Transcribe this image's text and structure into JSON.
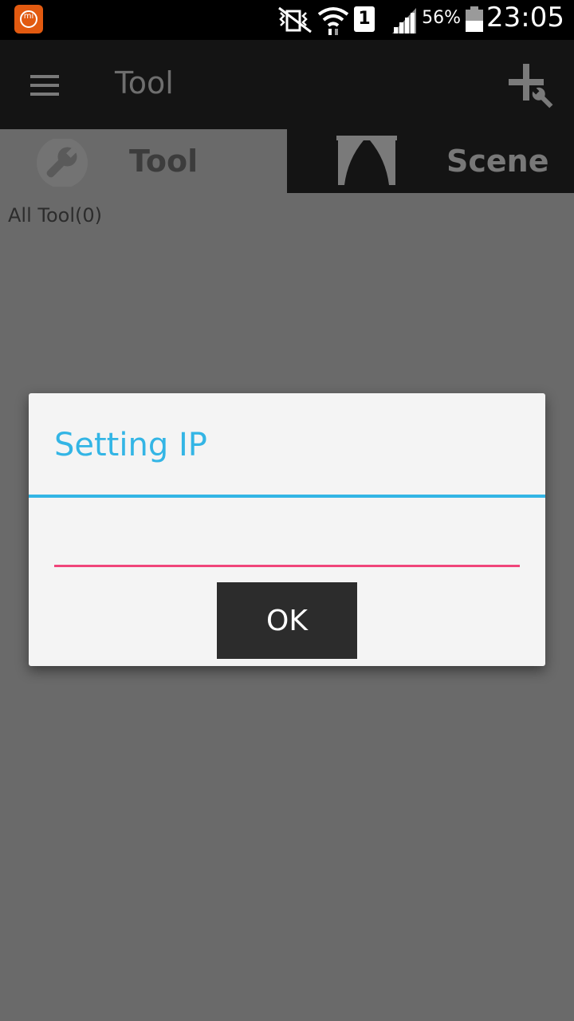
{
  "status_bar": {
    "battery_percent": "56%",
    "time": "23:05",
    "sim_slot": "1",
    "icons": [
      "mi-logo-icon",
      "vibrate-mute-icon",
      "wifi-icon",
      "sim-icon",
      "signal-icon",
      "battery-icon"
    ]
  },
  "app_bar": {
    "title": "Tool",
    "menu_icon": "hamburger-menu-icon",
    "action_icon": "add-tool-icon"
  },
  "tabs": [
    {
      "label": "Tool",
      "icon": "wrench-icon",
      "selected": true
    },
    {
      "label": "Scene",
      "icon": "curtain-icon",
      "selected": false
    }
  ],
  "list_header": "All Tool(0)",
  "dialog": {
    "title": "Setting IP",
    "input_value": "",
    "ok_label": "OK"
  },
  "colors": {
    "accent_blue": "#33b5e5",
    "input_underline": "#f0457a",
    "app_bar": "#141414",
    "overlay_bg": "#6a6a6a"
  }
}
